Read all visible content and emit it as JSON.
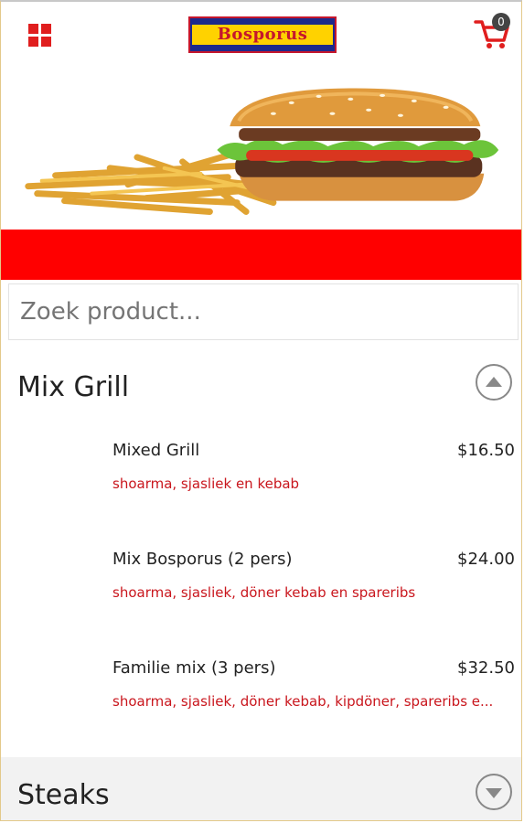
{
  "header": {
    "logo_text": "Bosporus",
    "cart_count": "0",
    "menu_icon": "grid-menu-icon",
    "cart_icon": "shopping-cart-icon"
  },
  "colors": {
    "accent_red": "#ff0000",
    "description_red": "#c9161d",
    "logo_blue": "#1d2a8c",
    "logo_yellow": "#ffd200"
  },
  "search": {
    "placeholder": "Zoek product..."
  },
  "categories": [
    {
      "title": "Mix Grill",
      "expanded": true,
      "items": [
        {
          "name": "Mixed Grill",
          "price": "$16.50",
          "description": "shoarma, sjasliek en kebab"
        },
        {
          "name": "Mix Bosporus (2 pers)",
          "price": "$24.00",
          "description": "shoarma, sjasliek, döner kebab en spareribs"
        },
        {
          "name": "Familie mix (3 pers)",
          "price": "$32.50",
          "description": "shoarma, sjasliek, döner kebab, kipdöner, spareribs e..."
        }
      ]
    },
    {
      "title": "Steaks",
      "expanded": false,
      "items": []
    }
  ]
}
